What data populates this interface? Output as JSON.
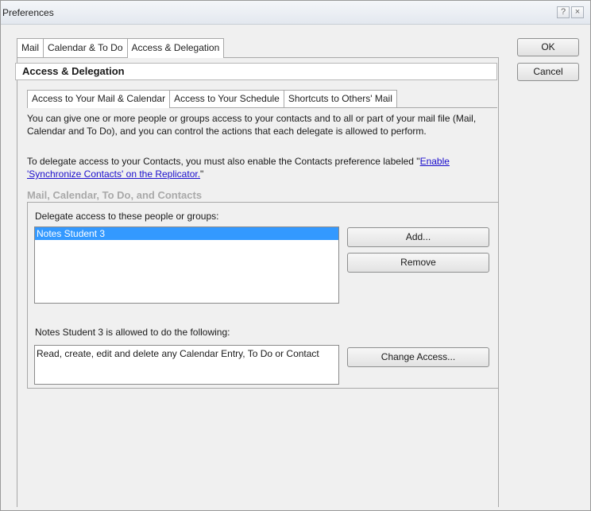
{
  "window": {
    "title": "Preferences",
    "help_label": "?",
    "close_label": "×"
  },
  "tabs": [
    {
      "label": "Mail",
      "selected": false
    },
    {
      "label": "Calendar & To Do",
      "selected": false
    },
    {
      "label": "Access & Delegation",
      "selected": true
    }
  ],
  "dialog_buttons": {
    "ok": "OK",
    "cancel": "Cancel"
  },
  "section": {
    "title": "Access & Delegation"
  },
  "subtabs": [
    {
      "label": "Access to Your Mail & Calendar",
      "selected": true
    },
    {
      "label": "Access to Your Schedule",
      "selected": false
    },
    {
      "label": "Shortcuts to Others' Mail",
      "selected": false
    }
  ],
  "content": {
    "intro": "You can give one or more people or groups access to your contacts and to all or part of your mail file (Mail, Calendar and To Do), and you can control the actions that each delegate is allowed to perform.",
    "contacts_note_prefix": "To delegate access to your Contacts, you must also enable the Contacts preference labeled \"",
    "contacts_note_link": "Enable 'Synchronize Contacts' on the Replicator.",
    "contacts_note_suffix": "\""
  },
  "group": {
    "title": "Mail, Calendar, To Do, and Contacts",
    "delegate_label": "Delegate access to these people or groups:",
    "delegates": [
      "Notes Student 3"
    ],
    "selected_delegate": "Notes Student 3",
    "allowed_label": "Notes Student 3 is allowed to do the following:",
    "allowed_text": "Read, create, edit and delete any Calendar Entry, To Do or Contact",
    "add_button": "Add...",
    "remove_button": "Remove",
    "change_access_button": "Change Access..."
  },
  "colors": {
    "selection": "#3399ff",
    "link": "#1a0dcc",
    "group_label": "#a9a9a9",
    "dialog_bg": "#f0f0f0"
  }
}
